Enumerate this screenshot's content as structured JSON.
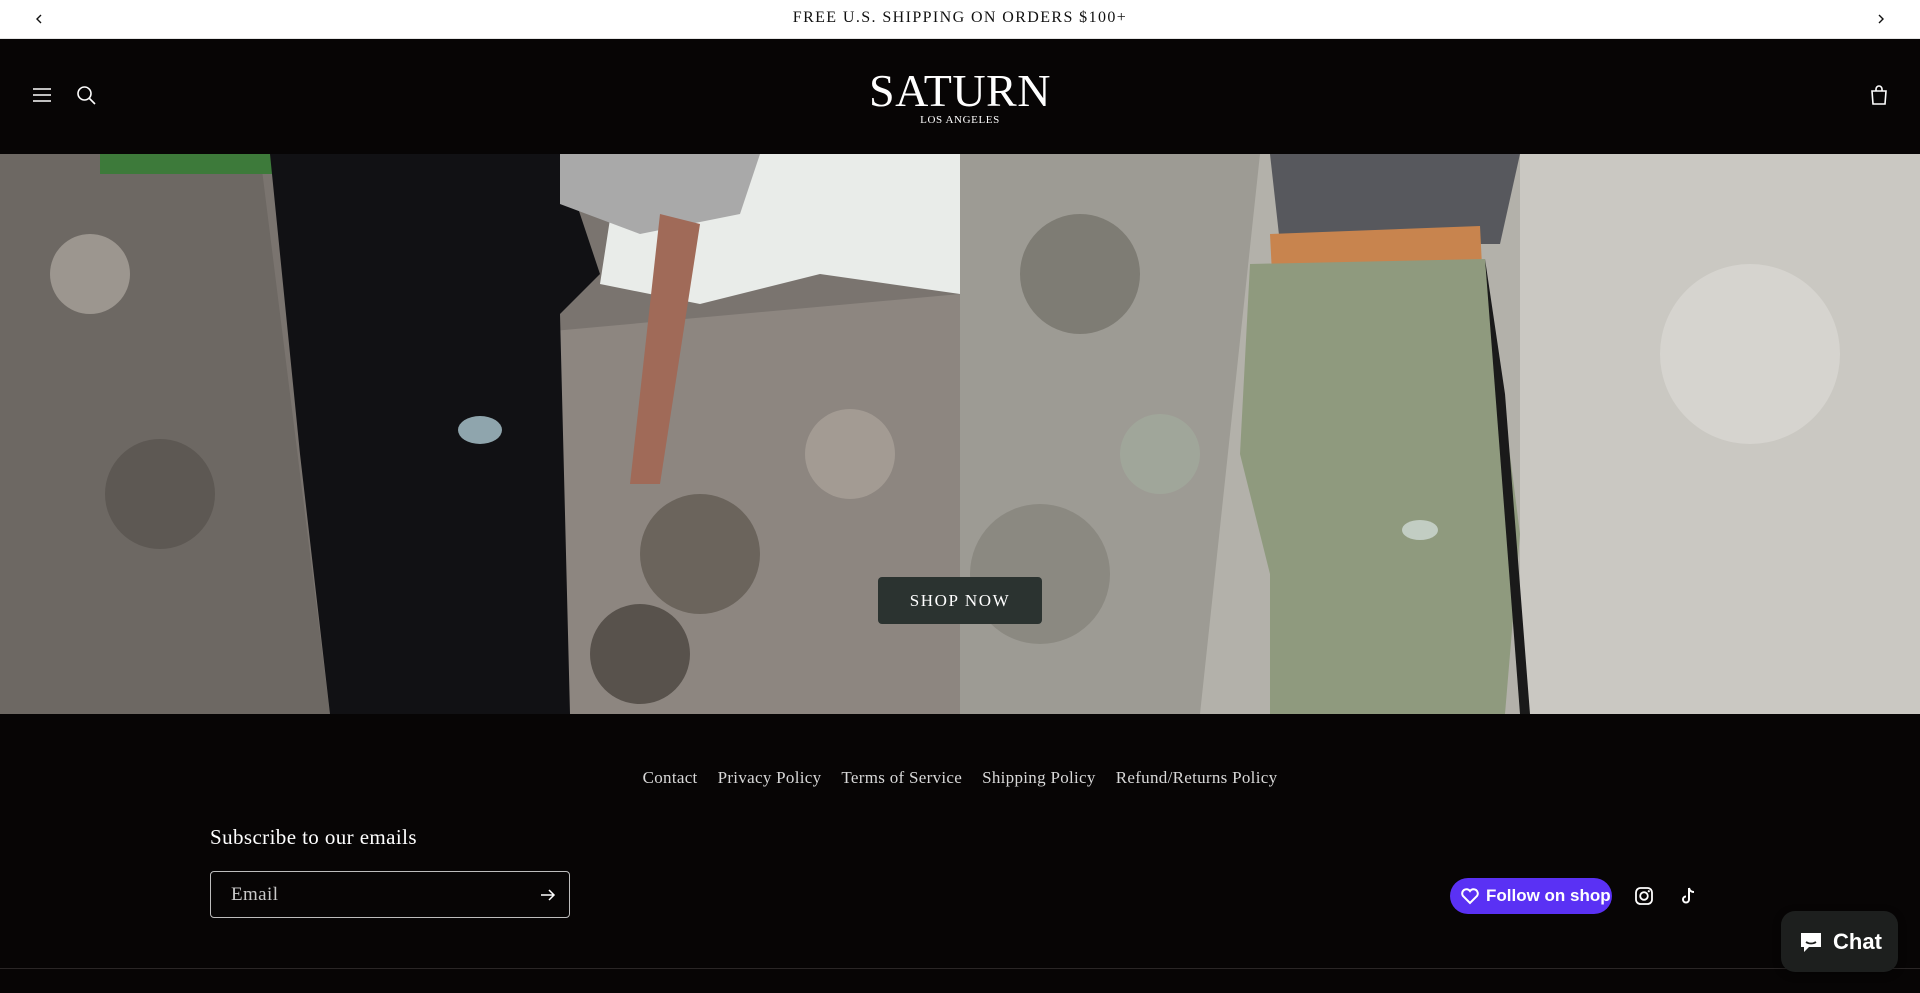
{
  "announcement": {
    "message": "FREE U.S. SHIPPING ON ORDERS $100+",
    "prev_icon": "chevron-left-icon",
    "next_icon": "chevron-right-icon"
  },
  "header": {
    "logo_text": "SATURN",
    "logo_subtext": "LOS ANGELES",
    "menu_icon": "hamburger-icon",
    "search_icon": "search-icon",
    "cart_icon": "cart-icon"
  },
  "hero": {
    "cta_label": "SHOP NOW"
  },
  "footer": {
    "links": [
      "Contact",
      "Privacy Policy",
      "Terms of Service",
      "Shipping Policy",
      "Refund/Returns Policy"
    ],
    "subscribe_title": "Subscribe to our emails",
    "email_placeholder": "Email",
    "submit_icon": "arrow-right-icon",
    "follow_label": "Follow on shop",
    "follow_color": "#5a31f4",
    "social": [
      "instagram-icon",
      "tiktok-icon"
    ]
  },
  "chat": {
    "label": "Chat",
    "icon": "chat-bubble-icon"
  }
}
